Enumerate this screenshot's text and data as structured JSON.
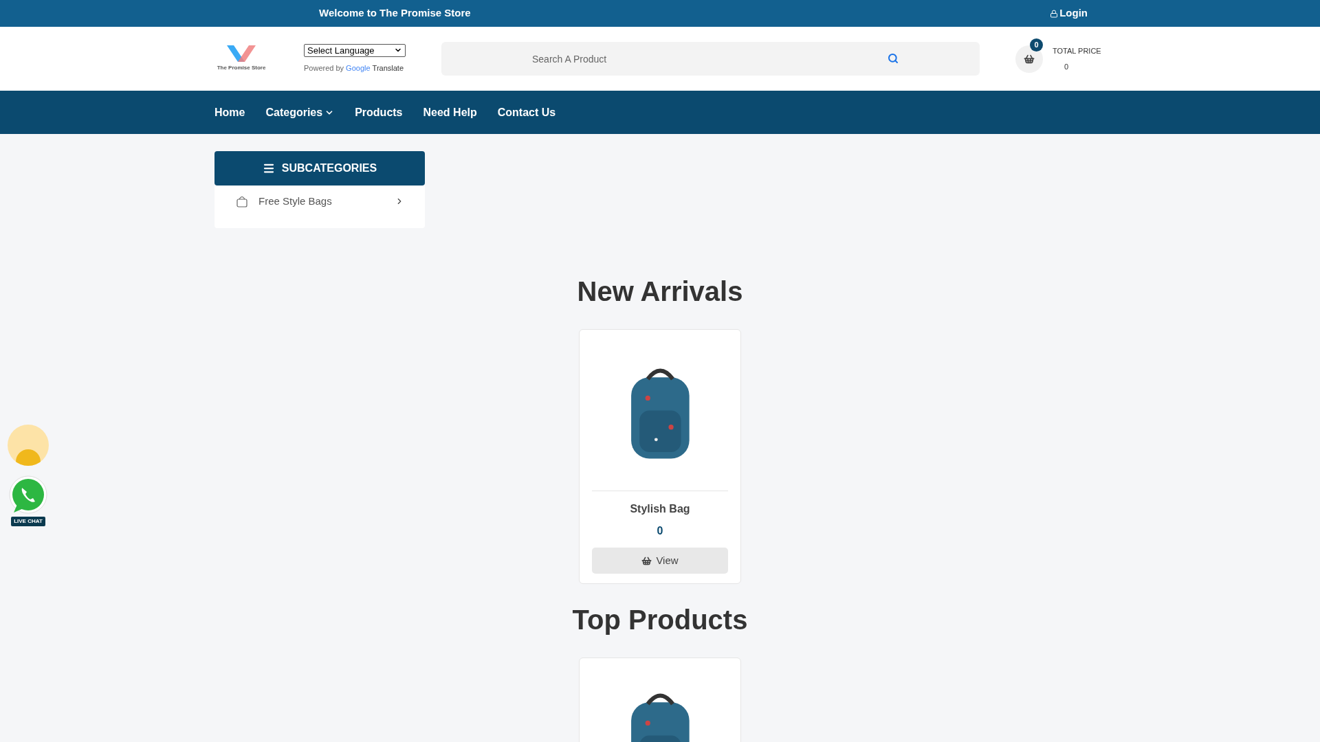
{
  "top_bar": {
    "welcome": "Welcome to The Promise Store",
    "login": "Login"
  },
  "header": {
    "logo_text": "The Promise Store",
    "language_select": "Select Language",
    "powered_by": "Powered by",
    "google": "Google",
    "translate": "Translate",
    "search": {
      "placeholder": "Search A Product"
    },
    "cart_count": "0",
    "total_label": "TOTAL PRICE",
    "total_value": "0"
  },
  "nav": [
    {
      "label": "Home",
      "dropdown": false
    },
    {
      "label": "Categories",
      "dropdown": true
    },
    {
      "label": "Products",
      "dropdown": false
    },
    {
      "label": "Need Help",
      "dropdown": false
    },
    {
      "label": "Contact Us",
      "dropdown": false
    }
  ],
  "sidebar": {
    "title": "SUBCATEGORIES",
    "items": [
      {
        "label": "Free Style Bags"
      }
    ]
  },
  "sections": [
    {
      "title": "New Arrivals",
      "products": [
        {
          "kind": "full",
          "name": "Stylish Bag",
          "price": "0",
          "button": "View"
        }
      ]
    },
    {
      "title": "Top Products",
      "products": [
        {
          "kind": "image_only"
        }
      ]
    }
  ],
  "float": {
    "live_chat": "LIVE CHAT"
  }
}
